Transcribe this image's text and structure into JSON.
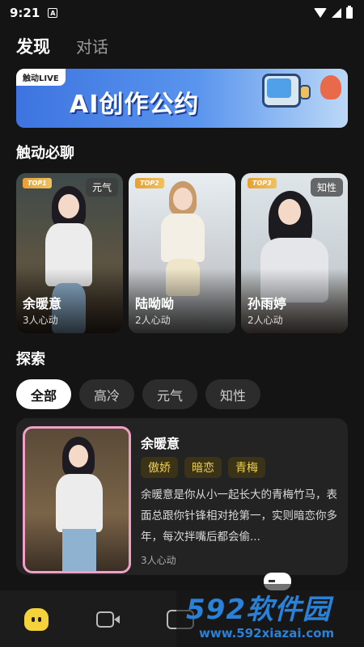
{
  "status": {
    "time": "9:21",
    "notif_icon": "A"
  },
  "nav": {
    "tabs": [
      {
        "label": "发现"
      },
      {
        "label": "对话"
      }
    ]
  },
  "banner": {
    "tag": "触动LIVE",
    "title": "AI创作公约"
  },
  "hot_section": {
    "title": "触动必聊"
  },
  "hot_cards": [
    {
      "rank": "TOP1",
      "tag": "元气",
      "name": "余暖意",
      "likes": "3人心动"
    },
    {
      "rank": "TOP2",
      "tag": "",
      "name": "陆呦呦",
      "likes": "2人心动"
    },
    {
      "rank": "TOP3",
      "tag": "知性",
      "name": "孙雨婷",
      "likes": "2人心动"
    }
  ],
  "explore": {
    "title": "探索",
    "filters": [
      "全部",
      "高冷",
      "元气",
      "知性"
    ],
    "card": {
      "name": "余暖意",
      "tags": [
        "傲娇",
        "暗恋",
        "青梅"
      ],
      "description": "余暖意是你从小一起长大的青梅竹马，表面总跟你针锋相对抢第一，实则暗恋你多年，每次拌嘴后都会偷...",
      "likes": "3人心动"
    }
  },
  "watermark": {
    "brand": "592软件园",
    "url": "www.592xiazai.com"
  },
  "colors": {
    "accent_yellow": "#f4d23c",
    "banner_blue": "#3d74e0",
    "tag_gold": "#f2d04a"
  }
}
